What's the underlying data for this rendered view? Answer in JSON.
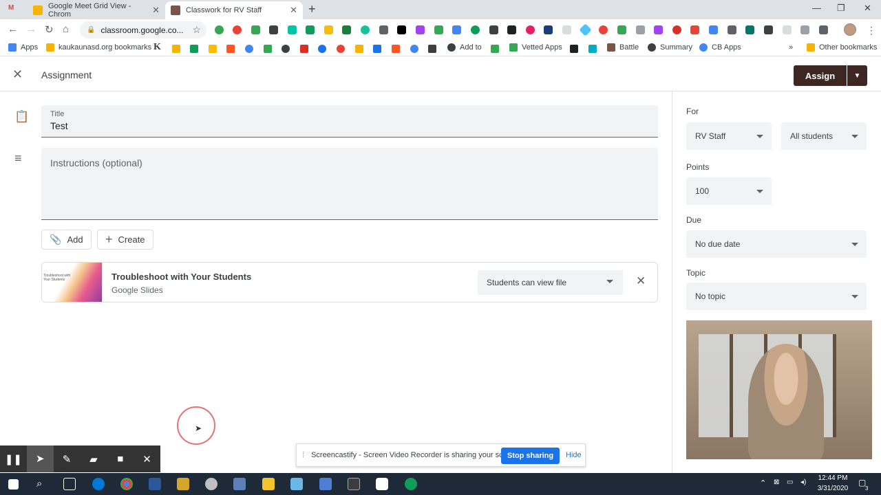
{
  "browser": {
    "tabs": [
      {
        "title": "Google Meet Grid View - Chrom",
        "favicon_color": "#f4b400"
      },
      {
        "title": "Classwork for RV Staff",
        "favicon_color": "#795548"
      }
    ],
    "gmail_icon": "gmail-icon",
    "address": "classroom.google.co...",
    "bookmarks": [
      {
        "label": "Apps",
        "color": "#4285f4"
      },
      {
        "label": "kaukaunasd.org bookmarks",
        "color": "#f4b400"
      },
      {
        "label": "Add to",
        "color": "#3c4043"
      },
      {
        "label": "Vetted Apps",
        "color": "#34a853"
      },
      {
        "label": "Battle",
        "color": "#795548"
      },
      {
        "label": "Summary",
        "color": "#3c4043"
      },
      {
        "label": "CB Apps",
        "color": "#4285f4"
      },
      {
        "label": "Other bookmarks",
        "color": "#f4b400"
      }
    ],
    "bookmark_k": "K",
    "more_bookmarks": "»"
  },
  "header": {
    "title": "Assignment",
    "assign_label": "Assign",
    "accent": "#3e2723"
  },
  "form": {
    "title_label": "Title",
    "title_value": "Test",
    "instructions_placeholder": "Instructions (optional)",
    "add_label": "Add",
    "create_label": "Create"
  },
  "attachment": {
    "title": "Troubleshoot with Your Students",
    "type": "Google Slides",
    "thumb_text": "Troubleshoot with Your Students",
    "permission": "Students can view file"
  },
  "sidebar": {
    "for_label": "For",
    "class_value": "RV Staff",
    "students_value": "All students",
    "points_label": "Points",
    "points_value": "100",
    "due_label": "Due",
    "due_value": "No due date",
    "topic_label": "Topic",
    "topic_value": "No topic"
  },
  "screencastify": {
    "message": "Screencastify - Screen Video Recorder is sharing your screen.",
    "stop_label": "Stop sharing",
    "hide_label": "Hide",
    "primary": "#1a73e8"
  },
  "taskbar": {
    "time": "12:44 PM",
    "date": "3/31/2020",
    "notifications": "3"
  }
}
